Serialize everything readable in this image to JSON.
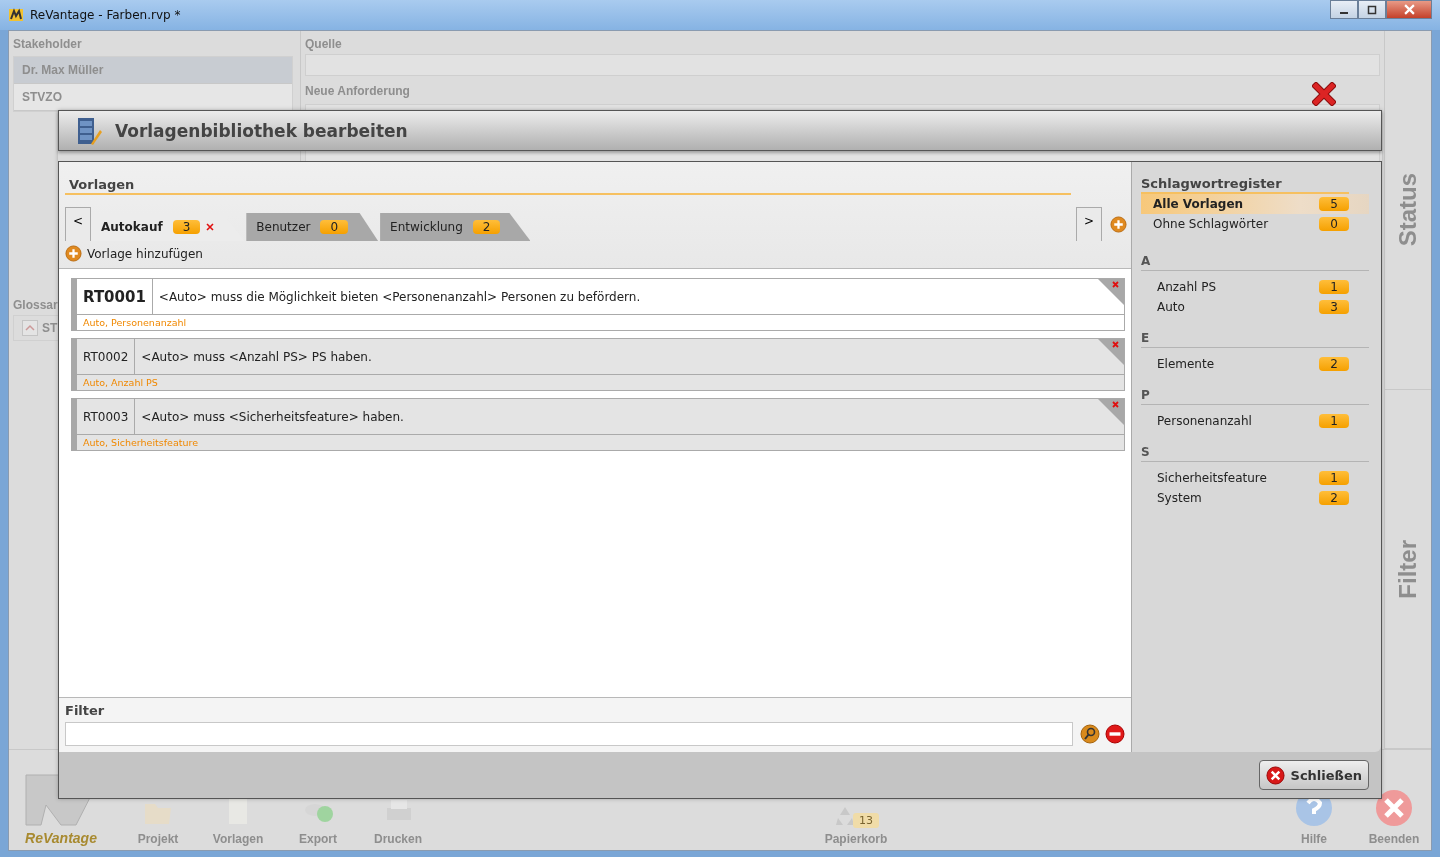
{
  "window": {
    "title": "ReVantage - Farben.rvp *"
  },
  "background": {
    "stakeholder": {
      "label": "Stakeholder",
      "items": [
        {
          "label": "Dr. Max Müller",
          "selected": true
        },
        {
          "label": "STVZO",
          "selected": false
        }
      ]
    },
    "source": {
      "label": "Quelle"
    },
    "new_requirement": {
      "label": "Neue Anforderung"
    },
    "glossary": {
      "label": "Glossar",
      "item": "ST"
    },
    "side_tabs": [
      "Status",
      "Filter"
    ],
    "toolbar": {
      "logo": "ReVantage",
      "items": [
        "Projekt",
        "Vorlagen",
        "Export",
        "Drucken"
      ],
      "trash": {
        "label": "Papierkorb",
        "count": "13"
      },
      "right_items": [
        "Hilfe",
        "Beenden"
      ]
    }
  },
  "dialog": {
    "title": "Vorlagenbibliothek bearbeiten",
    "templates_heading": "Vorlagen",
    "prev": "<",
    "next": ">",
    "tabs": [
      {
        "label": "Autokauf",
        "count": "3",
        "selected": true
      },
      {
        "label": "Benutzer",
        "count": "0",
        "selected": false
      },
      {
        "label": "Entwicklung",
        "count": "2",
        "selected": false
      }
    ],
    "add_label": "Vorlage hinzufügen",
    "templates": [
      {
        "id": "RT0001",
        "text": "<Auto> muss die Möglichkeit bieten <Personenanzahl> Personen zu befördern.",
        "tags": "Auto, Personenanzahl",
        "selected": true
      },
      {
        "id": "RT0002",
        "text": "<Auto> muss  <Anzahl PS> PS haben.",
        "tags": "Auto, Anzahl PS",
        "selected": false
      },
      {
        "id": "RT0003",
        "text": "<Auto> muss <Sicherheitsfeature> haben.",
        "tags": "Auto, Sicherheitsfeature",
        "selected": false
      }
    ],
    "filter": {
      "label": "Filter"
    },
    "keywords": {
      "title": "Schlagwortregister",
      "top": [
        {
          "label": "Alle Vorlagen",
          "count": "5",
          "selected": true
        },
        {
          "label": "Ohne Schlagwörter",
          "count": "0",
          "selected": false
        }
      ],
      "groups": [
        {
          "letter": "A",
          "items": [
            {
              "label": "Anzahl PS",
              "count": "1"
            },
            {
              "label": "Auto",
              "count": "3"
            }
          ]
        },
        {
          "letter": "E",
          "items": [
            {
              "label": "Elemente",
              "count": "2"
            }
          ]
        },
        {
          "letter": "P",
          "items": [
            {
              "label": "Personenanzahl",
              "count": "1"
            }
          ]
        },
        {
          "letter": "S",
          "items": [
            {
              "label": "Sicherheitsfeature",
              "count": "1"
            },
            {
              "label": "System",
              "count": "2"
            }
          ]
        }
      ]
    },
    "close_button": "Schließen"
  }
}
